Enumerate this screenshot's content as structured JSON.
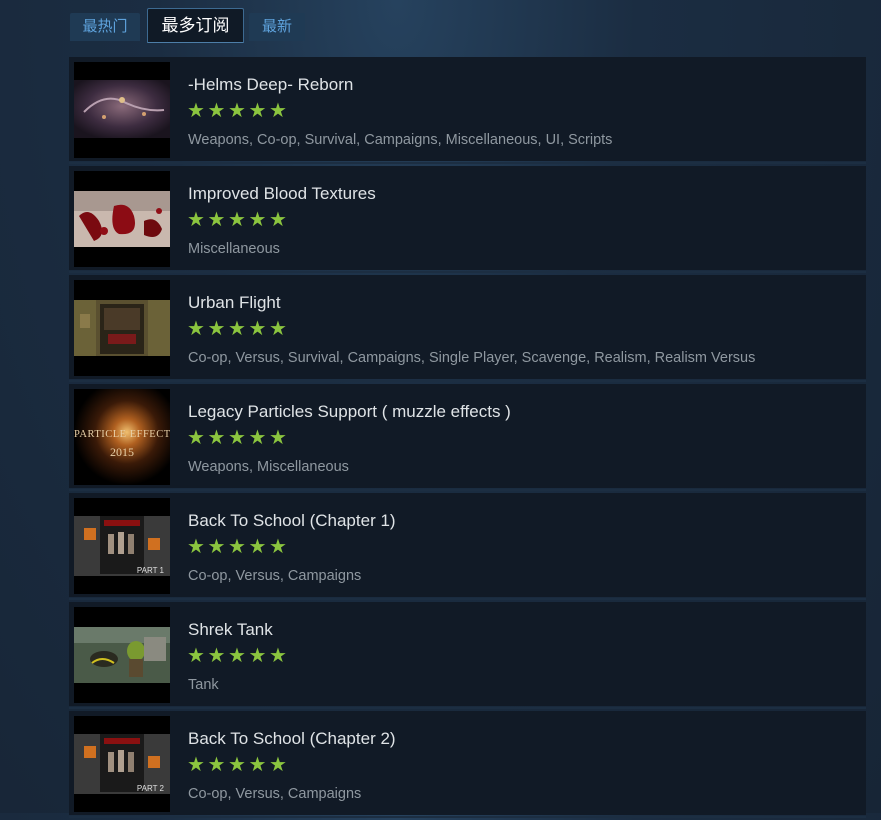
{
  "tabs": {
    "hot": "最热门",
    "most_subscribed": "最多订阅",
    "newest": "最新",
    "active": "most_subscribed"
  },
  "colors": {
    "background": "#1b2d42",
    "item_background": "#111a26",
    "star": "#8bc53f",
    "title": "#dfe3e6",
    "tags": "#8f98a0",
    "tab_text": "#5ea2dc"
  },
  "items": [
    {
      "title": "-Helms Deep- Reborn",
      "rating": 5,
      "stars": "★★★★★",
      "tags": "Weapons, Co-op, Survival, Campaigns, Miscellaneous, UI, Scripts",
      "thumb_icon": "fortress-map-thumbnail"
    },
    {
      "title": "Improved Blood Textures",
      "rating": 5,
      "stars": "★★★★★",
      "tags": "Miscellaneous",
      "thumb_icon": "blood-splatter-thumbnail"
    },
    {
      "title": "Urban Flight",
      "rating": 5,
      "stars": "★★★★★",
      "tags": "Co-op, Versus, Survival, Campaigns, Single Player, Scavenge, Realism, Realism Versus",
      "thumb_icon": "campaign-poster-thumbnail"
    },
    {
      "title": "Legacy Particles Support ( muzzle effects )",
      "rating": 5,
      "stars": "★★★★★",
      "tags": "Weapons, Miscellaneous",
      "thumb_icon": "particle-effects-thumbnail",
      "thumb_text": "PARTICLE EFFECTS",
      "thumb_subtext": "2015"
    },
    {
      "title": "Back To School (Chapter 1)",
      "rating": 5,
      "stars": "★★★★★",
      "tags": "Co-op, Versus, Campaigns",
      "thumb_icon": "school-poster-thumbnail",
      "thumb_text": "PART 1"
    },
    {
      "title": "Shrek Tank",
      "rating": 5,
      "stars": "★★★★★",
      "tags": "Tank",
      "thumb_icon": "shrek-thumbnail"
    },
    {
      "title": "Back To School (Chapter 2)",
      "rating": 5,
      "stars": "★★★★★",
      "tags": "Co-op, Versus, Campaigns",
      "thumb_icon": "school-poster-thumbnail",
      "thumb_text": "PART 2"
    }
  ]
}
